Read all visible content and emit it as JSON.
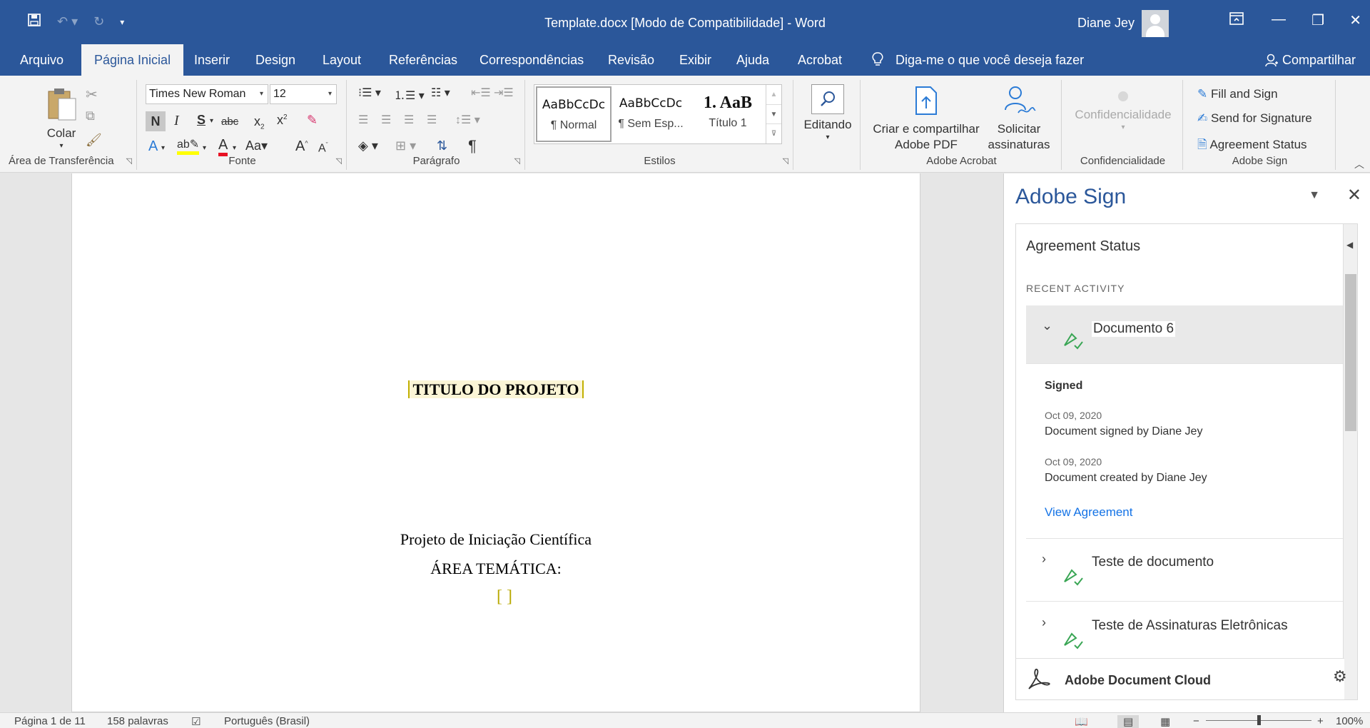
{
  "window": {
    "title": "Template.docx [Modo de Compatibilidade]  -  Word",
    "user_name": "Diane Jey"
  },
  "tabs": [
    "Arquivo",
    "Página Inicial",
    "Inserir",
    "Design",
    "Layout",
    "Referências",
    "Correspondências",
    "Revisão",
    "Exibir",
    "Ajuda",
    "Acrobat"
  ],
  "active_tab": "Página Inicial",
  "tell_me": "Diga-me o que você deseja fazer",
  "share": "Compartilhar",
  "ribbon": {
    "clipboard": {
      "paste": "Colar",
      "label": "Área de Transferência"
    },
    "font": {
      "name": "Times New Roman",
      "size": "12",
      "bold": "N",
      "italic": "I",
      "underline": "S",
      "strike": "abc",
      "label": "Fonte",
      "grow": "A",
      "shrink": "A",
      "case": "Aa"
    },
    "paragraph": {
      "label": "Parágrafo",
      "pilcrow": "¶"
    },
    "styles": {
      "label": "Estilos",
      "items": [
        {
          "sample": "AaBbCcDc",
          "name": "¶ Normal"
        },
        {
          "sample": "AaBbCcDc",
          "name": "¶ Sem Esp..."
        },
        {
          "sample": "1.  AaB",
          "name": "Título 1"
        }
      ]
    },
    "editing": {
      "label": "Editando"
    },
    "acrobat": {
      "create_line1": "Criar e compartilhar",
      "create_line2": "Adobe PDF",
      "request_line1": "Solicitar",
      "request_line2": "assinaturas",
      "label": "Adobe Acrobat"
    },
    "confidentiality": {
      "button": "Confidencialidade",
      "label": "Confidencialidade"
    },
    "adobe_sign": {
      "fill": "Fill and Sign",
      "send": "Send for Signature",
      "status": "Agreement Status",
      "label": "Adobe Sign"
    }
  },
  "document": {
    "title": "TITULO DO PROJETO",
    "line1": "Projeto de Iniciação Científica",
    "line2": "ÁREA TEMÁTICA:",
    "placeholder": "[ ]"
  },
  "pane": {
    "title": "Adobe Sign",
    "section": "Agreement Status",
    "recent": "RECENT ACTIVITY",
    "items": [
      {
        "name": "Documento 6",
        "status": "Signed",
        "events": [
          {
            "date": "Oct 09, 2020",
            "text": "Document signed by Diane Jey"
          },
          {
            "date": "Oct 09, 2020",
            "text": "Document created by Diane Jey"
          }
        ],
        "link": "View Agreement"
      },
      {
        "name": "Teste de documento"
      },
      {
        "name": "Teste de Assinaturas Eletrônicas"
      }
    ],
    "footer": "Adobe Document Cloud"
  },
  "status": {
    "page": "Página 1 de 11",
    "words": "158 palavras",
    "language": "Português (Brasil)",
    "zoom": "100%"
  },
  "colors": {
    "word_blue": "#2b579a",
    "link_blue": "#1473e6",
    "sign_green": "#3aa655"
  }
}
